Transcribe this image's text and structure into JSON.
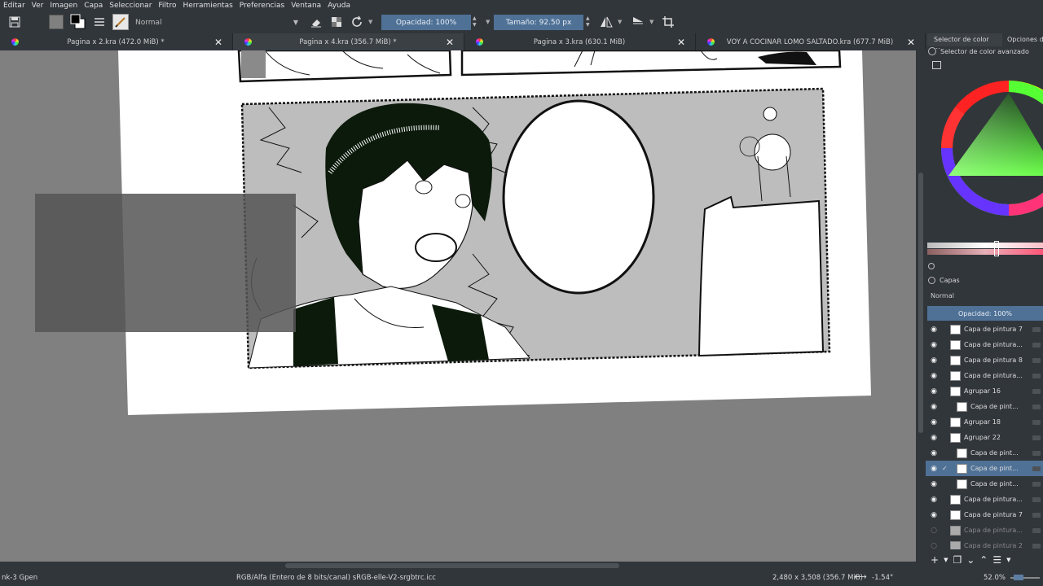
{
  "menu": [
    "Editar",
    "Ver",
    "Imagen",
    "Capa",
    "Seleccionar",
    "Filtro",
    "Herramientas",
    "Preferencias",
    "Ventana",
    "Ayuda"
  ],
  "toolbar": {
    "blend_mode": "Normal",
    "opacity_label": "Opacidad: 100%",
    "size_label": "Tamaño: 92.50 px"
  },
  "tabs": [
    {
      "label": "Pagina x 2.kra (472.0 MiB) *"
    },
    {
      "label": "Pagina x 4.kra (356.7 MiB) *"
    },
    {
      "label": "Pagina x 3.kra (630.1 MiB)"
    },
    {
      "label": "VOY A COCINAR LOMO SALTADO.kra (677.7 MiB)"
    }
  ],
  "panel": {
    "tab1": "Selector de color ...",
    "tab2": "Opciones de",
    "advanced_selector": "Selector de color avanzado",
    "layers_title": "Capas",
    "layers_mode": "Normal",
    "layers_opacity": "Opacidad:  100%",
    "layers": [
      {
        "name": "Capa de pintura 7",
        "visible": true,
        "selected": false,
        "indent": 0
      },
      {
        "name": "Capa de pintura...",
        "visible": true,
        "selected": false,
        "indent": 0
      },
      {
        "name": "Capa de pintura 8",
        "visible": true,
        "selected": false,
        "indent": 0
      },
      {
        "name": "Capa de pintura...",
        "visible": true,
        "selected": false,
        "indent": 0
      },
      {
        "name": "Agrupar 16",
        "visible": true,
        "selected": false,
        "indent": 0
      },
      {
        "name": "Capa de pint...",
        "visible": true,
        "selected": false,
        "indent": 1
      },
      {
        "name": "Agrupar 18",
        "visible": true,
        "selected": false,
        "indent": 0
      },
      {
        "name": "Agrupar 22",
        "visible": true,
        "selected": false,
        "indent": 0
      },
      {
        "name": "Capa de pint...",
        "visible": true,
        "selected": false,
        "indent": 1
      },
      {
        "name": "Capa de pint...",
        "visible": true,
        "selected": true,
        "indent": 1
      },
      {
        "name": "Capa de pint...",
        "visible": true,
        "selected": false,
        "indent": 1
      },
      {
        "name": "Capa de pintura...",
        "visible": true,
        "selected": false,
        "indent": 0
      },
      {
        "name": "Capa de pintura 7",
        "visible": true,
        "selected": false,
        "indent": 0
      },
      {
        "name": "Capa de pintura...",
        "visible": false,
        "selected": false,
        "indent": 0
      },
      {
        "name": "Capa de pintura 2",
        "visible": false,
        "selected": false,
        "indent": 0
      }
    ]
  },
  "status": {
    "brush": "nk-3 Gpen",
    "color_info": "RGB/Alfa (Entero de 8 bits/canal)  sRGB-elle-V2-srgbtrc.icc",
    "dims": "2,480 x 3,508 (356.7 MiB)",
    "rotation": "-1.54°",
    "zoom": "52.0%"
  },
  "colors": {
    "ui_bg": "#31363b",
    "accent": "#5d7ea3",
    "canvas_bg": "#808080"
  }
}
